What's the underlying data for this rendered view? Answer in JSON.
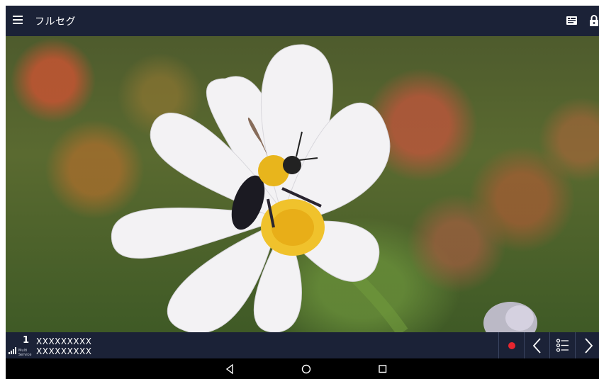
{
  "header": {
    "title": "フルセグ",
    "menu_icon": "hamburger-menu-icon",
    "action_icons": [
      "subtitle-info-icon",
      "lock-icon"
    ]
  },
  "video": {
    "description_icon": "tv-video-frame"
  },
  "footer": {
    "channel_number": "1",
    "channel_name": "XXXXXXXXX",
    "program_name": "XXXXXXXXX",
    "multi_label": "Multi",
    "service_label": "Service",
    "record_color": "#e8262f",
    "controls": [
      "record-icon",
      "chevron-left-icon",
      "channel-list-icon",
      "chevron-right-icon"
    ]
  },
  "navbar": {
    "buttons": [
      "back-triangle-icon",
      "home-circle-icon",
      "recents-square-icon"
    ]
  }
}
